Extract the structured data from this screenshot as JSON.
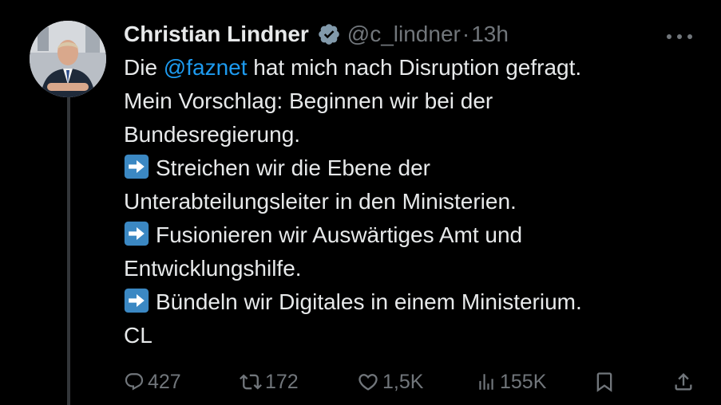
{
  "author": {
    "name": "Christian Lindner",
    "handle": "@c_lindner",
    "separator": "·",
    "time": "13h",
    "verified": true
  },
  "tweet": {
    "line1_prefix": "Die ",
    "line1_mention": "@faznet",
    "line1_suffix": " hat mich nach Disruption gefragt.",
    "line2": "Mein Vorschlag: Beginnen wir bei der",
    "line3": "Bundesregierung.",
    "line4": "Streichen wir die Ebene der",
    "line5": "Unterabteilungsleiter in den Ministerien.",
    "line6": "Fusionieren wir Auswärtiges Amt und",
    "line7": "Entwicklungshilfe.",
    "line8": "Bündeln wir Digitales in einem Ministerium.",
    "line9": "CL"
  },
  "stats": {
    "replies": "427",
    "reposts": "172",
    "likes": "1,5K",
    "views": "155K"
  },
  "icons": {
    "reply": "reply-icon",
    "repost": "repost-icon",
    "like": "like-icon",
    "views": "views-icon",
    "bookmark": "bookmark-icon",
    "share": "share-icon",
    "more": "more-icon",
    "verified": "verified-badge-icon",
    "arrow_emoji": "right-arrow-emoji-icon"
  },
  "colors": {
    "background": "#000000",
    "text": "#e7e9ea",
    "secondary": "#71767b",
    "link": "#1d9bf0",
    "emoji_blue": "#3b88c3"
  }
}
